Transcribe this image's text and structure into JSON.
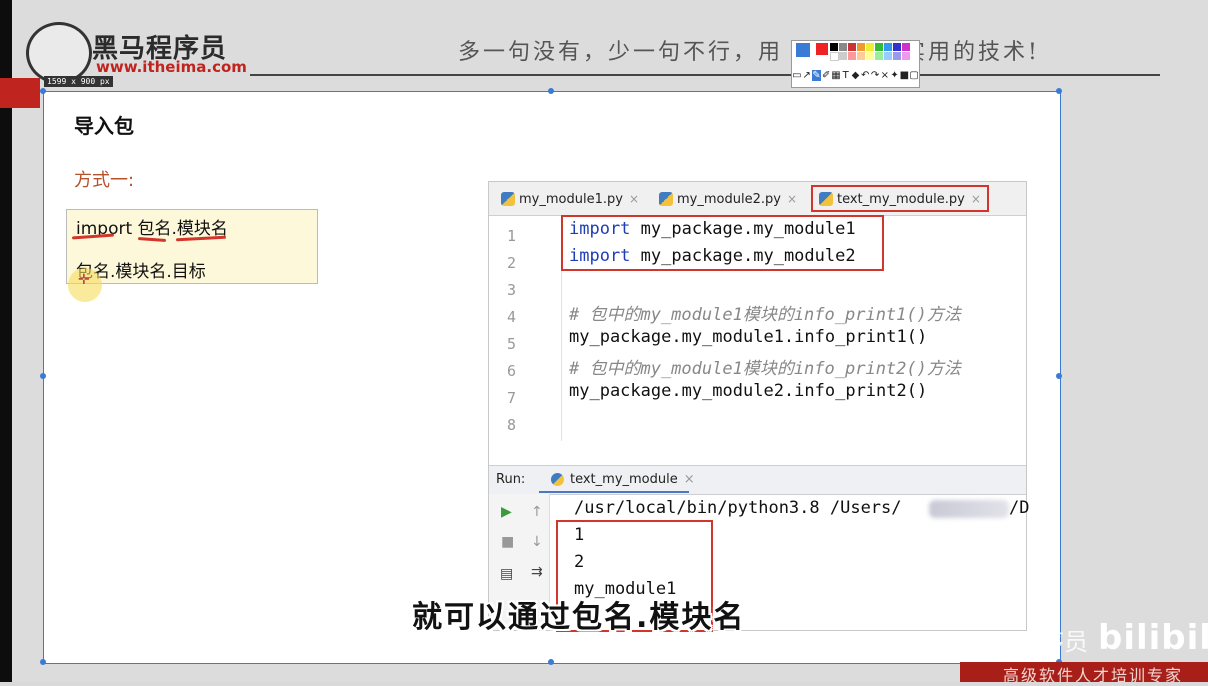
{
  "header": {
    "brand_cn": "黑马程序员",
    "brand_url": "www.itheima.com",
    "size_tag": "1599 x 900  px",
    "slogan": "多一句没有，少一句不行，用 最 教会最实用的技术!"
  },
  "slide": {
    "title": "导入包",
    "method": "方式一:",
    "note_line1": "import 包名.模块名",
    "note_line2": "包名.模块名.目标"
  },
  "ide": {
    "tabs": [
      {
        "label": "my_module1.py"
      },
      {
        "label": "my_module2.py"
      },
      {
        "label": "text_my_module.py"
      }
    ],
    "line_numbers": [
      "1",
      "2",
      "3",
      "4",
      "5",
      "6",
      "7",
      "8"
    ],
    "code": {
      "l1_kw": "import",
      "l1_rest": " my_package.my_module1",
      "l2_kw": "import",
      "l2_rest": " my_package.my_module2",
      "l4": "# 包中的my_module1模块的info_print1()方法",
      "l5": "my_package.my_module1.info_print1()",
      "l6": "# 包中的my_module1模块的info_print2()方法",
      "l7": "my_package.my_module2.info_print2()"
    },
    "run": {
      "label": "Run:",
      "tab": "text_my_module",
      "command": "/usr/local/bin/python3.8 /Users/",
      "command_tail": "/D",
      "output": [
        "1",
        "2",
        "my_module1"
      ]
    }
  },
  "subtitle": "就可以通过包名.模块名",
  "watermark": {
    "text": "序员",
    "bilibili": "bilibili",
    "bottom": "高级软件人才培训专家"
  },
  "colors": {
    "accent_red": "#d2352a",
    "keyword_blue": "#1d3eb4",
    "selection_blue": "#3a7bd5"
  }
}
